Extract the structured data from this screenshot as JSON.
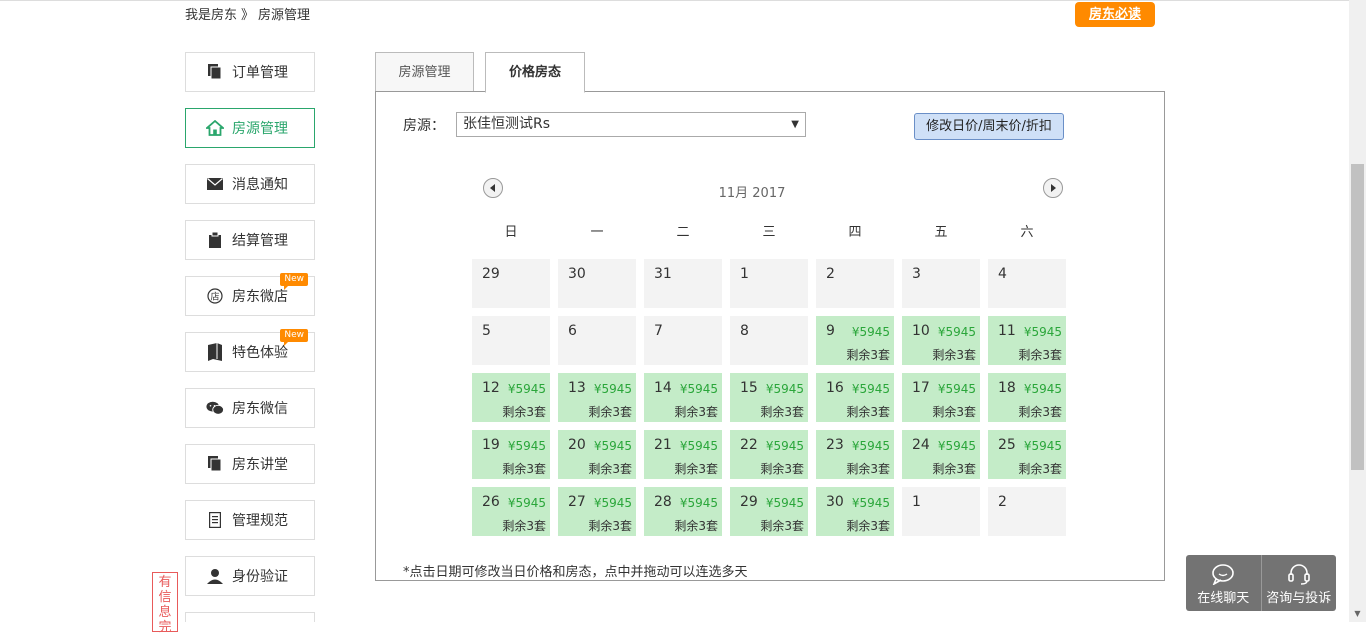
{
  "breadcrumb": {
    "home": "我是房东",
    "sep": "》",
    "current": "房源管理"
  },
  "top_button": "房东必读",
  "sidebar": {
    "items": [
      {
        "label": "订单管理",
        "icon": "document-icon"
      },
      {
        "label": "房源管理",
        "icon": "house-icon",
        "active": true
      },
      {
        "label": "消息通知",
        "icon": "mail-icon"
      },
      {
        "label": "结算管理",
        "icon": "clipboard-icon"
      },
      {
        "label": "房东微店",
        "icon": "shop-icon",
        "badge": "New"
      },
      {
        "label": "特色体验",
        "icon": "book-icon",
        "badge": "New"
      },
      {
        "label": "房东微信",
        "icon": "wechat-icon"
      },
      {
        "label": "房东讲堂",
        "icon": "document-icon"
      },
      {
        "label": "管理规范",
        "icon": "list-icon"
      },
      {
        "label": "身份验证",
        "icon": "user-icon"
      }
    ]
  },
  "side_tag": "有信息完",
  "tabs": [
    {
      "label": "房源管理"
    },
    {
      "label": "价格房态",
      "active": true
    }
  ],
  "source": {
    "label": "房源：",
    "selected": "张佳恒测试Rs"
  },
  "modify_button": "修改日价/周末价/折扣",
  "calendar": {
    "month_label": "11月 2017",
    "weekdays": [
      "日",
      "一",
      "二",
      "三",
      "四",
      "五",
      "六"
    ],
    "price": "¥5945",
    "remaining": "剩余3套",
    "rows": [
      [
        {
          "d": "29",
          "a": false
        },
        {
          "d": "30",
          "a": false
        },
        {
          "d": "31",
          "a": false
        },
        {
          "d": "1",
          "a": false
        },
        {
          "d": "2",
          "a": false
        },
        {
          "d": "3",
          "a": false
        },
        {
          "d": "4",
          "a": false
        }
      ],
      [
        {
          "d": "5",
          "a": false
        },
        {
          "d": "6",
          "a": false
        },
        {
          "d": "7",
          "a": false
        },
        {
          "d": "8",
          "a": false
        },
        {
          "d": "9",
          "a": true
        },
        {
          "d": "10",
          "a": true
        },
        {
          "d": "11",
          "a": true
        }
      ],
      [
        {
          "d": "12",
          "a": true
        },
        {
          "d": "13",
          "a": true
        },
        {
          "d": "14",
          "a": true
        },
        {
          "d": "15",
          "a": true
        },
        {
          "d": "16",
          "a": true
        },
        {
          "d": "17",
          "a": true
        },
        {
          "d": "18",
          "a": true
        }
      ],
      [
        {
          "d": "19",
          "a": true
        },
        {
          "d": "20",
          "a": true
        },
        {
          "d": "21",
          "a": true
        },
        {
          "d": "22",
          "a": true
        },
        {
          "d": "23",
          "a": true
        },
        {
          "d": "24",
          "a": true
        },
        {
          "d": "25",
          "a": true
        }
      ],
      [
        {
          "d": "26",
          "a": true
        },
        {
          "d": "27",
          "a": true
        },
        {
          "d": "28",
          "a": true
        },
        {
          "d": "29",
          "a": true
        },
        {
          "d": "30",
          "a": true
        },
        {
          "d": "1",
          "a": false
        },
        {
          "d": "2",
          "a": false
        }
      ]
    ]
  },
  "hint": "*点击日期可修改当日价格和房态，点中并拖动可以连选多天",
  "float_widget": {
    "chat": "在线聊天",
    "consult": "咨询与投诉"
  }
}
